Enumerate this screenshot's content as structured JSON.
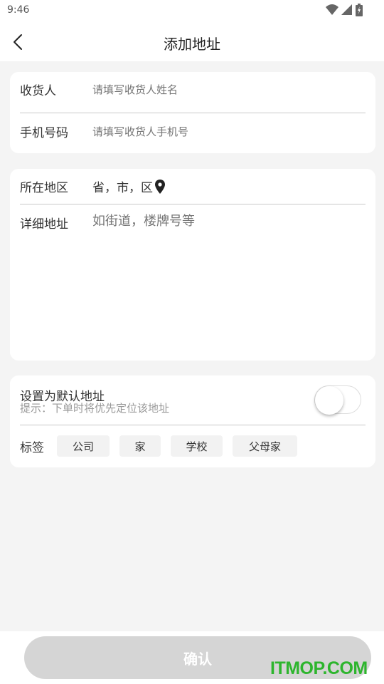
{
  "status": {
    "time": "9:46",
    "icons": [
      "wifi-icon",
      "signal-icon",
      "battery-icon"
    ]
  },
  "nav": {
    "title": "添加地址",
    "back_icon": "chevron-left-icon"
  },
  "contact": {
    "name_label": "收货人",
    "name_placeholder": "请填写收货人姓名",
    "phone_label": "手机号码",
    "phone_placeholder": "请填写收货人手机号"
  },
  "address": {
    "region_label": "所在地区",
    "region_value": "省，市，区",
    "region_icon": "location-pin-icon",
    "detail_label": "详细地址",
    "detail_placeholder": "如街道，楼牌号等"
  },
  "settings": {
    "default_label": "设置为默认地址",
    "default_hint": "提示：下单时将优先定位该地址",
    "default_on": false,
    "tag_label": "标签",
    "tags": [
      "公司",
      "家",
      "学校",
      "父母家"
    ]
  },
  "footer": {
    "confirm_label": "确认"
  },
  "watermark": "ITMOP.COM",
  "colors": {
    "background": "#f4f4f4",
    "card": "#ffffff",
    "button_disabled": "#d5d5d5",
    "watermark": "#2db52d"
  }
}
